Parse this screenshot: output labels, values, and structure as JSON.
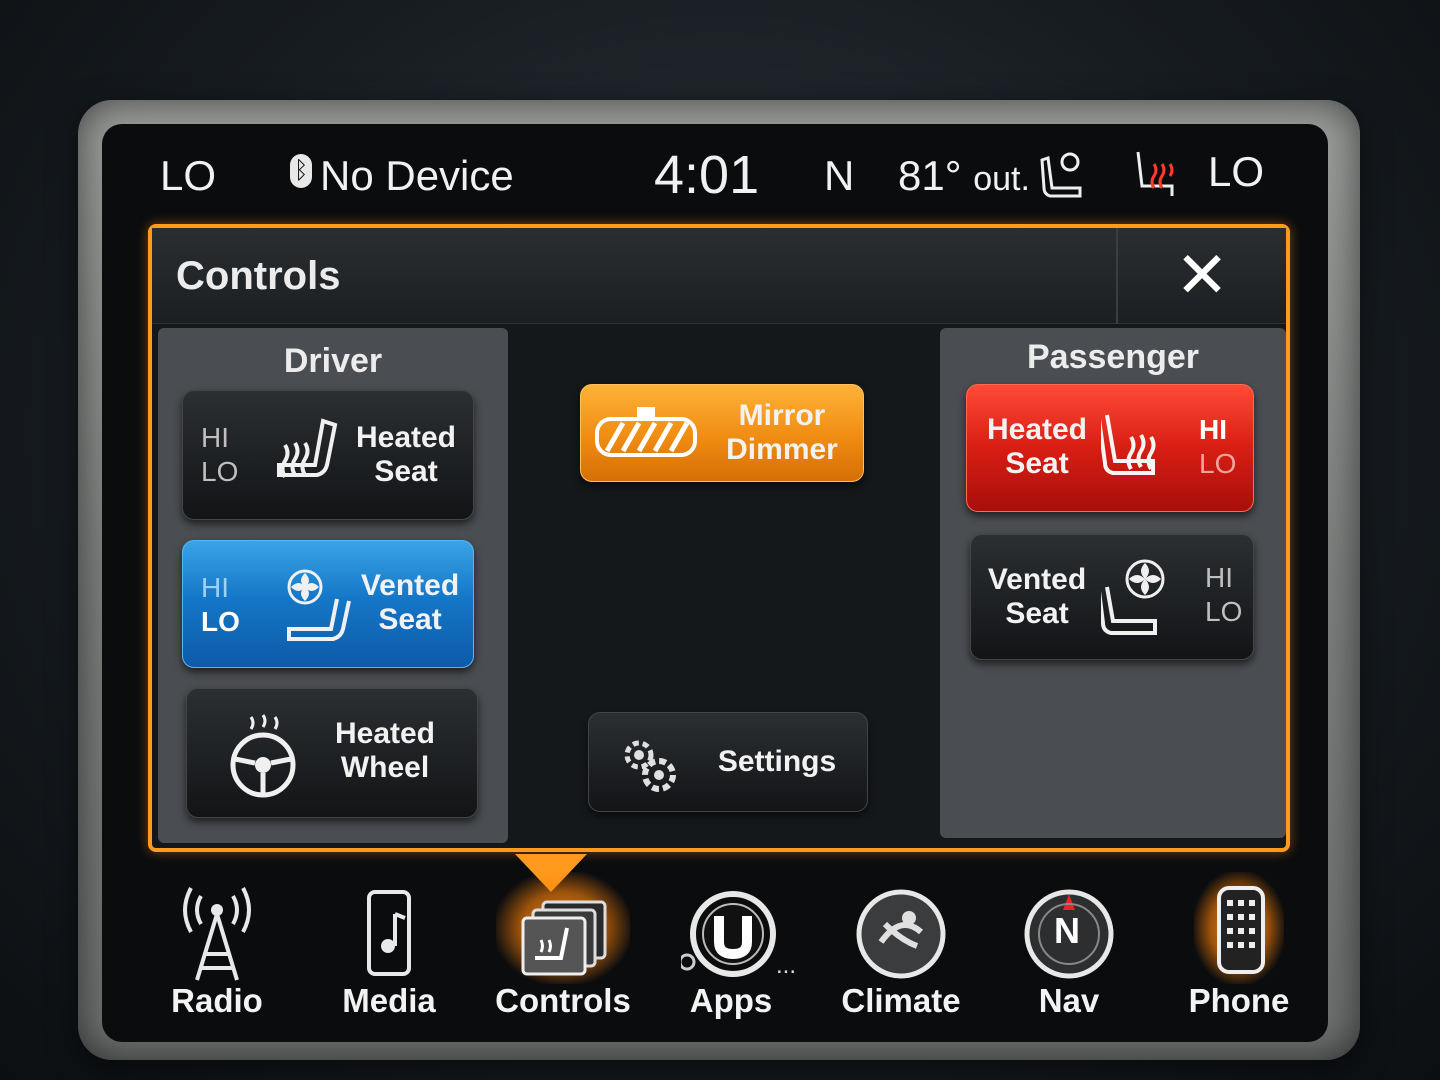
{
  "status_bar": {
    "left_temp": "LO",
    "device": "No Device",
    "time": "4:01",
    "compass": "N",
    "outside_temp": "81°",
    "outside_label": "out.",
    "right_temp": "LO"
  },
  "panel": {
    "title": "Controls",
    "close_label": "✕"
  },
  "driver": {
    "title": "Driver",
    "heated_seat": {
      "label_line1": "Heated",
      "label_line2": "Seat",
      "hi": "HI",
      "lo": "LO"
    },
    "vented_seat": {
      "label_line1": "Vented",
      "label_line2": "Seat",
      "hi": "HI",
      "lo": "LO",
      "active": "LO"
    },
    "heated_wheel": {
      "label_line1": "Heated",
      "label_line2": "Wheel"
    }
  },
  "center": {
    "mirror_dimmer": {
      "label_line1": "Mirror",
      "label_line2": "Dimmer"
    },
    "settings": {
      "label": "Settings"
    }
  },
  "passenger": {
    "title": "Passenger",
    "heated_seat": {
      "label_line1": "Heated",
      "label_line2": "Seat",
      "hi": "HI",
      "lo": "LO",
      "active": "HI"
    },
    "vented_seat": {
      "label_line1": "Vented",
      "label_line2": "Seat",
      "hi": "HI",
      "lo": "LO"
    }
  },
  "dock": {
    "radio": "Radio",
    "media": "Media",
    "controls": "Controls",
    "apps": "Apps",
    "climate": "Climate",
    "nav": "Nav",
    "nav_letter": "N",
    "phone": "Phone",
    "apps_dots": "..."
  },
  "colors": {
    "accent": "#ff9a1e",
    "heated_active": "#d81e14",
    "vented_active": "#1577c8"
  }
}
